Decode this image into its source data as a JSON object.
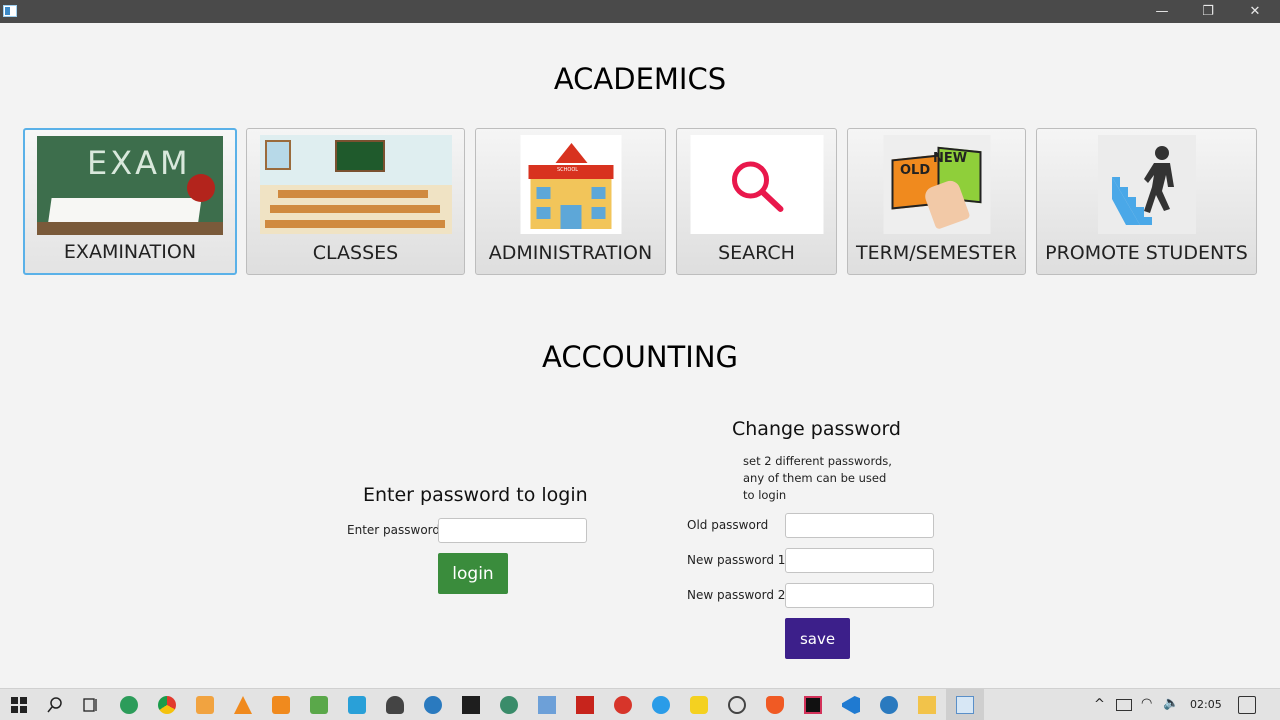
{
  "window": {
    "minimize": "—",
    "maximize": "❐",
    "close": "✕"
  },
  "academics": {
    "title": "ACADEMICS",
    "tiles": [
      {
        "label": "EXAMINATION",
        "image_text": "EXAM"
      },
      {
        "label": "CLASSES"
      },
      {
        "label": "ADMINISTRATION",
        "image_text": "SCHOOL"
      },
      {
        "label": "SEARCH"
      },
      {
        "label": "TERM/SEMESTER",
        "image_text_old": "OLD",
        "image_text_new": "NEW"
      },
      {
        "label": "PROMOTE STUDENTS"
      }
    ]
  },
  "accounting": {
    "title": "ACCOUNTING",
    "login": {
      "heading": "Enter password to login",
      "password_label": "Enter password",
      "password_value": "",
      "button": "login",
      "button_color": "#3a8c3c"
    },
    "change_password": {
      "heading": "Change password",
      "note_line1": "set 2 different passwords,",
      "note_line2": "any of them can be used",
      "note_line3": "to login",
      "old_label": "Old password",
      "new1_label": "New password 1",
      "new2_label": "New password 2",
      "button": "save",
      "button_color": "#3c1f8a"
    }
  },
  "taskbar": {
    "clock": "02:05",
    "icons": [
      "windows-start-icon",
      "search-icon",
      "task-view-icon",
      "app-icon",
      "chrome-icon",
      "media-icon",
      "vlc-icon",
      "app-icon",
      "qt-icon",
      "app-icon",
      "app-icon",
      "app-icon",
      "terminal-icon",
      "app-icon",
      "app-icon",
      "filezilla-icon",
      "app-icon",
      "twitter-icon",
      "app-icon",
      "app-icon",
      "brave-icon",
      "intellij-icon",
      "vscode-icon",
      "app-icon",
      "file-explorer-icon",
      "java-app-icon"
    ]
  }
}
